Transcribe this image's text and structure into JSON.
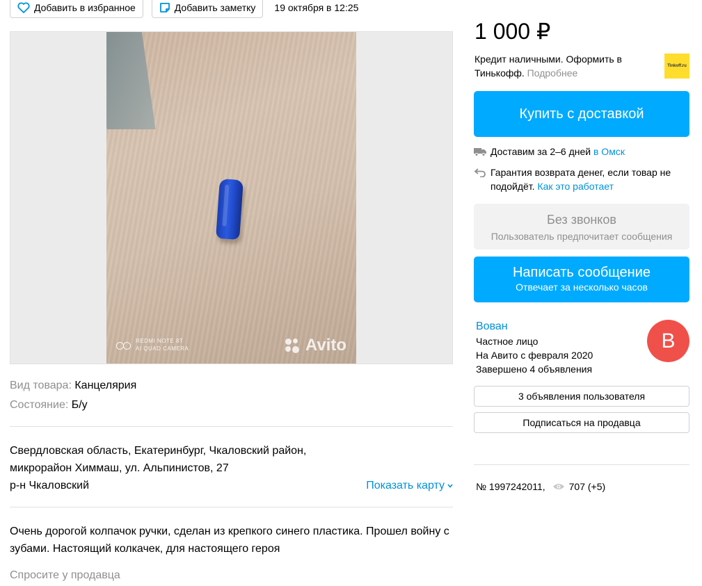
{
  "topbar": {
    "favorite_label": "Добавить в избранное",
    "note_label": "Добавить заметку",
    "date": "19 октября в 12:25"
  },
  "gallery": {
    "watermark_camera_line1": "REDMI NOTE 8T",
    "watermark_camera_line2": "AI QUAD CAMERA",
    "watermark_brand": "Avito"
  },
  "params": [
    {
      "key": "Вид товара:",
      "value": "Канцелярия"
    },
    {
      "key": "Состояние:",
      "value": "Б/у"
    }
  ],
  "address": {
    "line1": "Свердловская область, Екатеринбург, Чкаловский район,",
    "line2": "микрорайон Химмаш, ул. Альпинистов, 27",
    "district": "р-н Чкаловский",
    "show_map": "Показать карту"
  },
  "description": {
    "text": "Очень дорогой колпачок ручки, сделан из крепкого синего пластика. Прошел войну с зубами. Настоящий колкачек, для настоящего героя"
  },
  "ask_seller": "Спросите у продавца",
  "sidebar": {
    "price": "1 000 ₽",
    "credit": {
      "text": "Кредит наличными. Оформить в Тинькофф.",
      "more": "Подробнее",
      "logo_text": "Tinkoff.ru"
    },
    "buy_button": "Купить с доставкой",
    "delivery": {
      "text": "Доставим за 2–6 дней",
      "city": "в Омск"
    },
    "guarantee": {
      "text": "Гарантия возврата денег, если товар не подойдёт.",
      "link": "Как это работает"
    },
    "no_calls": {
      "title": "Без звонков",
      "subtitle": "Пользователь предпочитает сообщения"
    },
    "message": {
      "title": "Написать сообщение",
      "subtitle": "Отвечает за несколько часов"
    },
    "seller": {
      "name": "Вован",
      "type": "Частное лицо",
      "since": "На Авито с февраля 2020",
      "completed": "Завершено 4 объявления",
      "avatar_letter": "В"
    },
    "user_ads_button": "3 объявления пользователя",
    "subscribe_button": "Подписаться на продавца",
    "ad_number": "№ 1997242011,",
    "views": "707 (+5)"
  },
  "colors": {
    "accent": "#00aaff",
    "link": "#0091d9",
    "avatar": "#f0504a",
    "tinkoff": "#ffdd2d"
  }
}
